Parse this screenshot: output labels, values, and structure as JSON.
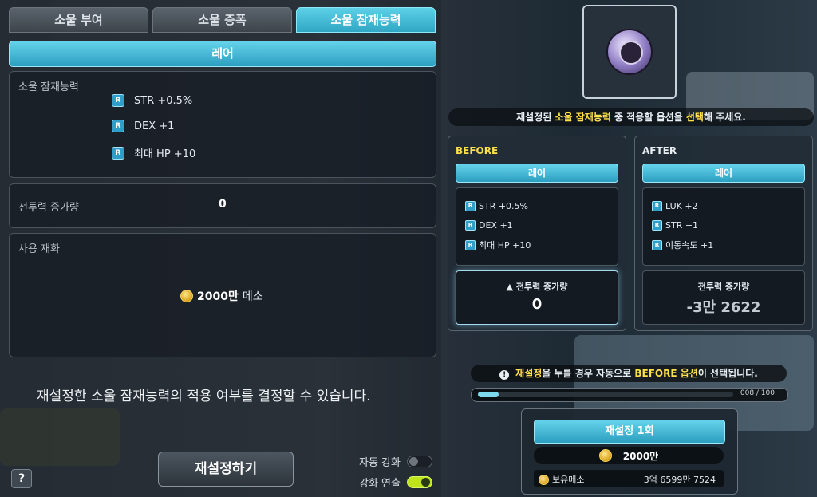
{
  "left": {
    "tabs": [
      {
        "label": "소울 부여"
      },
      {
        "label": "소울 증폭"
      },
      {
        "label": "소울 잠재능력"
      }
    ],
    "grade": "레어",
    "potential_label": "소울 잠재능력",
    "options": [
      "STR +0.5%",
      "DEX +1",
      "최대 HP +10"
    ],
    "option_badge": "R",
    "cp_label": "전투력 증가량",
    "cp_value": "0",
    "cost_label": "사용 재화",
    "cost_amount": "2000만",
    "cost_unit": "메소",
    "notice": "재설정한 소울 잠재능력의 적용 여부를 결정할 수 있습니다.",
    "help": "?",
    "reset_button": "재설정하기",
    "auto_enhance": "자동 강화",
    "enhance_chain": "강화 연출"
  },
  "right": {
    "instruction": {
      "pre": "재설정된 ",
      "hl1": "소울 잠재능력",
      "mid": " 중 적용할 옵션을 ",
      "hl2": "선택",
      "post": "해 주세요."
    },
    "before": {
      "title": "BEFORE",
      "grade": "레어",
      "options": [
        "STR +0.5%",
        "DEX +1",
        "최대 HP +10"
      ],
      "cp_label": "▲ 전투력 증가량",
      "cp_value": "0"
    },
    "after": {
      "title": "AFTER",
      "grade": "레어",
      "options": [
        "LUK +2",
        "STR +1",
        "이동속도 +1"
      ],
      "cp_label": "전투력 증가량",
      "cp_value": "-3만 2622"
    },
    "warning": {
      "icon": "!",
      "hl1": "재설정",
      "mid": "을 누를 경우 자동으로 ",
      "hl2": "BEFORE 옵션",
      "post": "이 선택됩니다."
    },
    "progress_text": "008 / 100",
    "progress_fraction": 0.08,
    "reset_count_button": "재설정 1회",
    "cost": "2000만",
    "meso_label": "보유메소",
    "meso_value": "3억 6599만 7524"
  },
  "colors": {
    "accent": "#2fa7c4",
    "highlight": "#ffe04a",
    "toggle_on": "#bfe41d"
  }
}
